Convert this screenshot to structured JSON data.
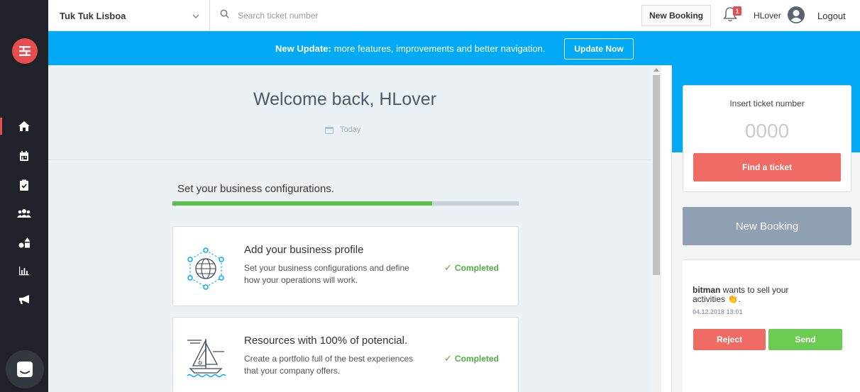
{
  "sidebar": {
    "logo_icon": "logo-icon",
    "items": [
      {
        "name": "home",
        "icon": "home-icon",
        "active": true
      },
      {
        "name": "calendar",
        "icon": "calendar-icon"
      },
      {
        "name": "tasks",
        "icon": "clipboard-check-icon"
      },
      {
        "name": "users",
        "icon": "users-icon"
      },
      {
        "name": "resources",
        "icon": "shapes-icon"
      },
      {
        "name": "reports",
        "icon": "bar-chart-icon"
      },
      {
        "name": "marketing",
        "icon": "megaphone-icon"
      }
    ],
    "chat_icon": "chat-icon"
  },
  "topbar": {
    "organization": "Tuk Tuk Lisboa",
    "search_placeholder": "Search ticket number",
    "new_booking_label": "New Booking",
    "notification_count": "1",
    "username": "HLover",
    "logout_label": "Logout"
  },
  "banner": {
    "bold": "New Update:",
    "text": "more features, improvements and better navigation.",
    "button_label": "Update Now"
  },
  "main": {
    "welcome": "Welcome back, HLover",
    "date_label": "Today",
    "config_title": "Set your business configurations.",
    "progress_percent": 75,
    "cards": [
      {
        "title": "Add your business profile",
        "description": "Set your business configurations and define how your operations will work.",
        "status": "Completed",
        "icon": "globe-network-icon"
      },
      {
        "title": "Resources with 100% of potencial.",
        "description": "Create a portfolio full of the best experiences that your company offers.",
        "status": "Completed",
        "icon": "sailboat-icon"
      }
    ]
  },
  "right_panel": {
    "ticket_label": "Insert ticket number",
    "ticket_placeholder": "0000",
    "find_button": "Find a ticket",
    "new_booking_button": "New Booking",
    "notification": {
      "user": "bitman",
      "text": "wants to sell your activities",
      "emoji": "👏",
      "date": "04.12.2018 13:01",
      "reject_label": "Reject",
      "send_label": "Send"
    }
  },
  "colors": {
    "sidebar_bg": "#1f2329",
    "accent_red": "#e84c4f",
    "banner_blue": "#02a9f4",
    "success_green": "#5cbf4b",
    "button_red": "#ef6b63",
    "button_green": "#6ccb52",
    "booking_gray": "#8fa1b2"
  }
}
